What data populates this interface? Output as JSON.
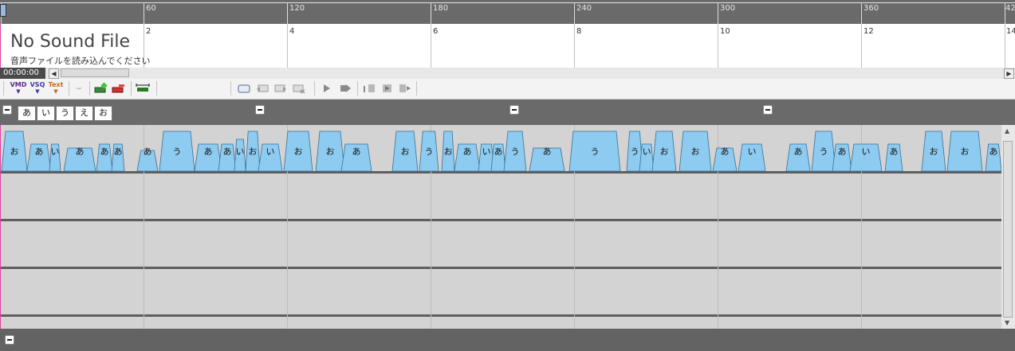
{
  "ruler": {
    "frame_labels": [
      "60",
      "120",
      "180",
      "240",
      "300",
      "360",
      "42"
    ]
  },
  "sound": {
    "title": "No Sound File",
    "subtitle": "音声ファイルを読み込んでください",
    "second_labels": [
      "2",
      "4",
      "6",
      "8",
      "10",
      "12",
      "14"
    ]
  },
  "scroll": {
    "time": "00:00:00",
    "left_arrow": "◀",
    "right_arrow": "▶"
  },
  "toolbar": {
    "vmd_label": "VMD",
    "vsq_label": "VSQ",
    "text_label": "Text"
  },
  "vowel_buttons": [
    "あ",
    "い",
    "う",
    "え",
    "お"
  ],
  "morph_labels": [
    "お",
    "あ",
    "い",
    "あ",
    "あ",
    "あ",
    "あ",
    "う",
    "あ",
    "あ",
    "い",
    "お",
    "い",
    "お",
    "お",
    "あ",
    "お",
    "う",
    "お",
    "あ",
    "い",
    "あ",
    "う",
    "あ",
    "う",
    "う",
    "い",
    "お",
    "お",
    "あ",
    "い",
    "あ",
    "う",
    "あ",
    "い",
    "あ",
    "お",
    "お",
    "あ"
  ],
  "colors": {
    "morph_fill": "#8ecbf0",
    "lane_bg": "#d3d3d3",
    "ruler_bg": "#6a6a6a"
  }
}
